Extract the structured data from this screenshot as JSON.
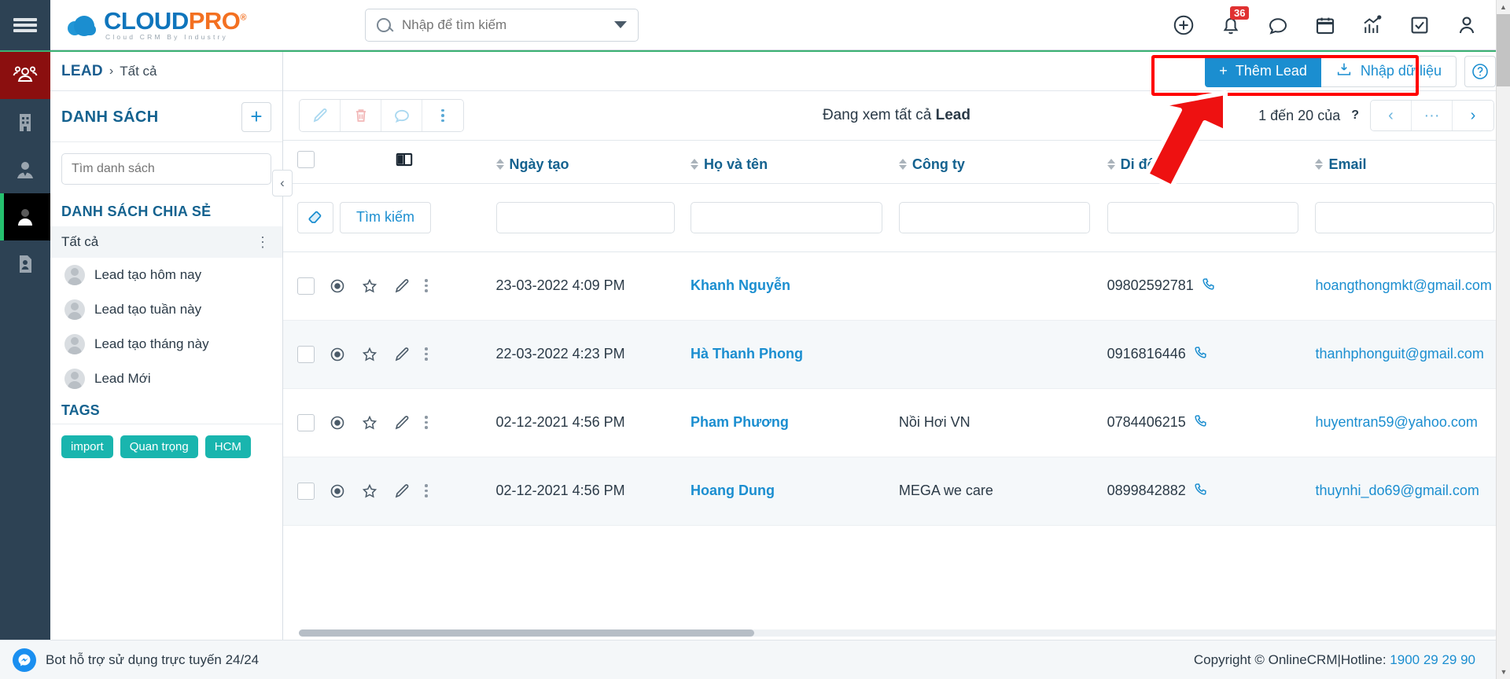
{
  "app": {
    "logo_main_blue": "CLOUD",
    "logo_main_orange": "PRO",
    "logo_reg": "®",
    "logo_sub": "Cloud CRM By Industry",
    "accent_blue": "#1b8ed0",
    "accent_orange": "#f37021",
    "rail_bg": "#2d4254",
    "active_red": "#8b0f0f",
    "tag_teal": "#19b5ae",
    "annotation_red": "#ff0000"
  },
  "search": {
    "placeholder": "Nhập để tìm kiếm"
  },
  "topbar": {
    "icons": [
      {
        "name": "plus-circle-icon",
        "label": "Thêm nhanh"
      },
      {
        "name": "bell-icon",
        "label": "Thông báo",
        "badge": "36"
      },
      {
        "name": "chat-icon",
        "label": "Tin nhắn"
      },
      {
        "name": "calendar-icon",
        "label": "Lịch"
      },
      {
        "name": "chart-icon",
        "label": "Báo cáo"
      },
      {
        "name": "checkbox-task-icon",
        "label": "Công việc"
      },
      {
        "name": "user-icon",
        "label": "Tài khoản"
      }
    ]
  },
  "rail": {
    "items": [
      {
        "name": "sidebar-group-icon",
        "label": "Khách hàng",
        "state": "active-red"
      },
      {
        "name": "sidebar-building-icon",
        "label": "Công ty",
        "state": ""
      },
      {
        "name": "sidebar-contact-icon",
        "label": "Liên hệ",
        "state": ""
      },
      {
        "name": "sidebar-person-icon",
        "label": "Lead",
        "state": "active-black"
      },
      {
        "name": "sidebar-document-person-icon",
        "label": "Hồ sơ",
        "state": ""
      }
    ]
  },
  "breadcrumb": {
    "main": "LEAD",
    "separator": "›",
    "sub": "Tất cả"
  },
  "list_panel": {
    "title": "DANH SÁCH",
    "add_label": "+",
    "search_placeholder": "Tìm danh sách",
    "shared_title": "DANH SÁCH CHIA SẺ",
    "selected_row": "Tất cả",
    "items": [
      {
        "label": "Lead tạo hôm nay"
      },
      {
        "label": "Lead tạo tuần này"
      },
      {
        "label": "Lead tạo tháng này"
      },
      {
        "label": "Lead Mới"
      }
    ],
    "tags_title": "TAGS",
    "tags": [
      "import",
      "Quan trọng",
      "HCM"
    ]
  },
  "actions": {
    "add_lead": "Thêm Lead",
    "import_data": "Nhập dữ liệu",
    "help": "?"
  },
  "toolbar": {
    "buttons": [
      {
        "name": "edit-button",
        "icon": "pencil-icon"
      },
      {
        "name": "delete-button",
        "icon": "trash-icon"
      },
      {
        "name": "comment-button",
        "icon": "comment-icon"
      },
      {
        "name": "more-button",
        "icon": "vertical-dots-icon"
      }
    ],
    "viewing_prefix": "Đang xem tất cả ",
    "viewing_entity": "Lead",
    "pager_text": "1 đến 20 của",
    "pager_total": "?",
    "pager_prev": "‹",
    "pager_more": "···",
    "pager_next": "›"
  },
  "table": {
    "columns": [
      {
        "key": "select",
        "label": ""
      },
      {
        "key": "layout",
        "label": ""
      },
      {
        "key": "created",
        "label": "Ngày tạo"
      },
      {
        "key": "fullname",
        "label": "Họ và tên"
      },
      {
        "key": "company",
        "label": "Công ty"
      },
      {
        "key": "mobile",
        "label": "Di động"
      },
      {
        "key": "email",
        "label": "Email"
      }
    ],
    "filter": {
      "erase_label": "erase-icon",
      "search_label": "Tìm kiếm",
      "values": {
        "created": "",
        "fullname": "",
        "company": "",
        "mobile": "",
        "email": ""
      }
    },
    "rows": [
      {
        "created": "23-03-2022 4:09 PM",
        "fullname": "Khanh Nguyễn",
        "company": "",
        "mobile": "09802592781",
        "email": "hoangthongmkt@gmail.com"
      },
      {
        "created": "22-03-2022 4:23 PM",
        "fullname": "Hà Thanh Phong",
        "company": "",
        "mobile": "0916816446",
        "email": "thanhphonguit@gmail.com"
      },
      {
        "created": "02-12-2021 4:56 PM",
        "fullname": "Pham Phương",
        "company": "Nồi Hơi VN",
        "mobile": "0784406215",
        "email": "huyentran59@yahoo.com"
      },
      {
        "created": "02-12-2021 4:56 PM",
        "fullname": "Hoang Dung",
        "company": "MEGA we care",
        "mobile": "0899842882",
        "email": "thuynhi_do69@gmail.com"
      }
    ]
  },
  "footer": {
    "bot_text": "Bot hỗ trợ sử dụng trực tuyến 24/24",
    "copyright": "Copyright © OnlineCRM",
    "divider": "|",
    "hotline_label": "Hotline:",
    "hotline_number": "1900 29 29 90"
  }
}
